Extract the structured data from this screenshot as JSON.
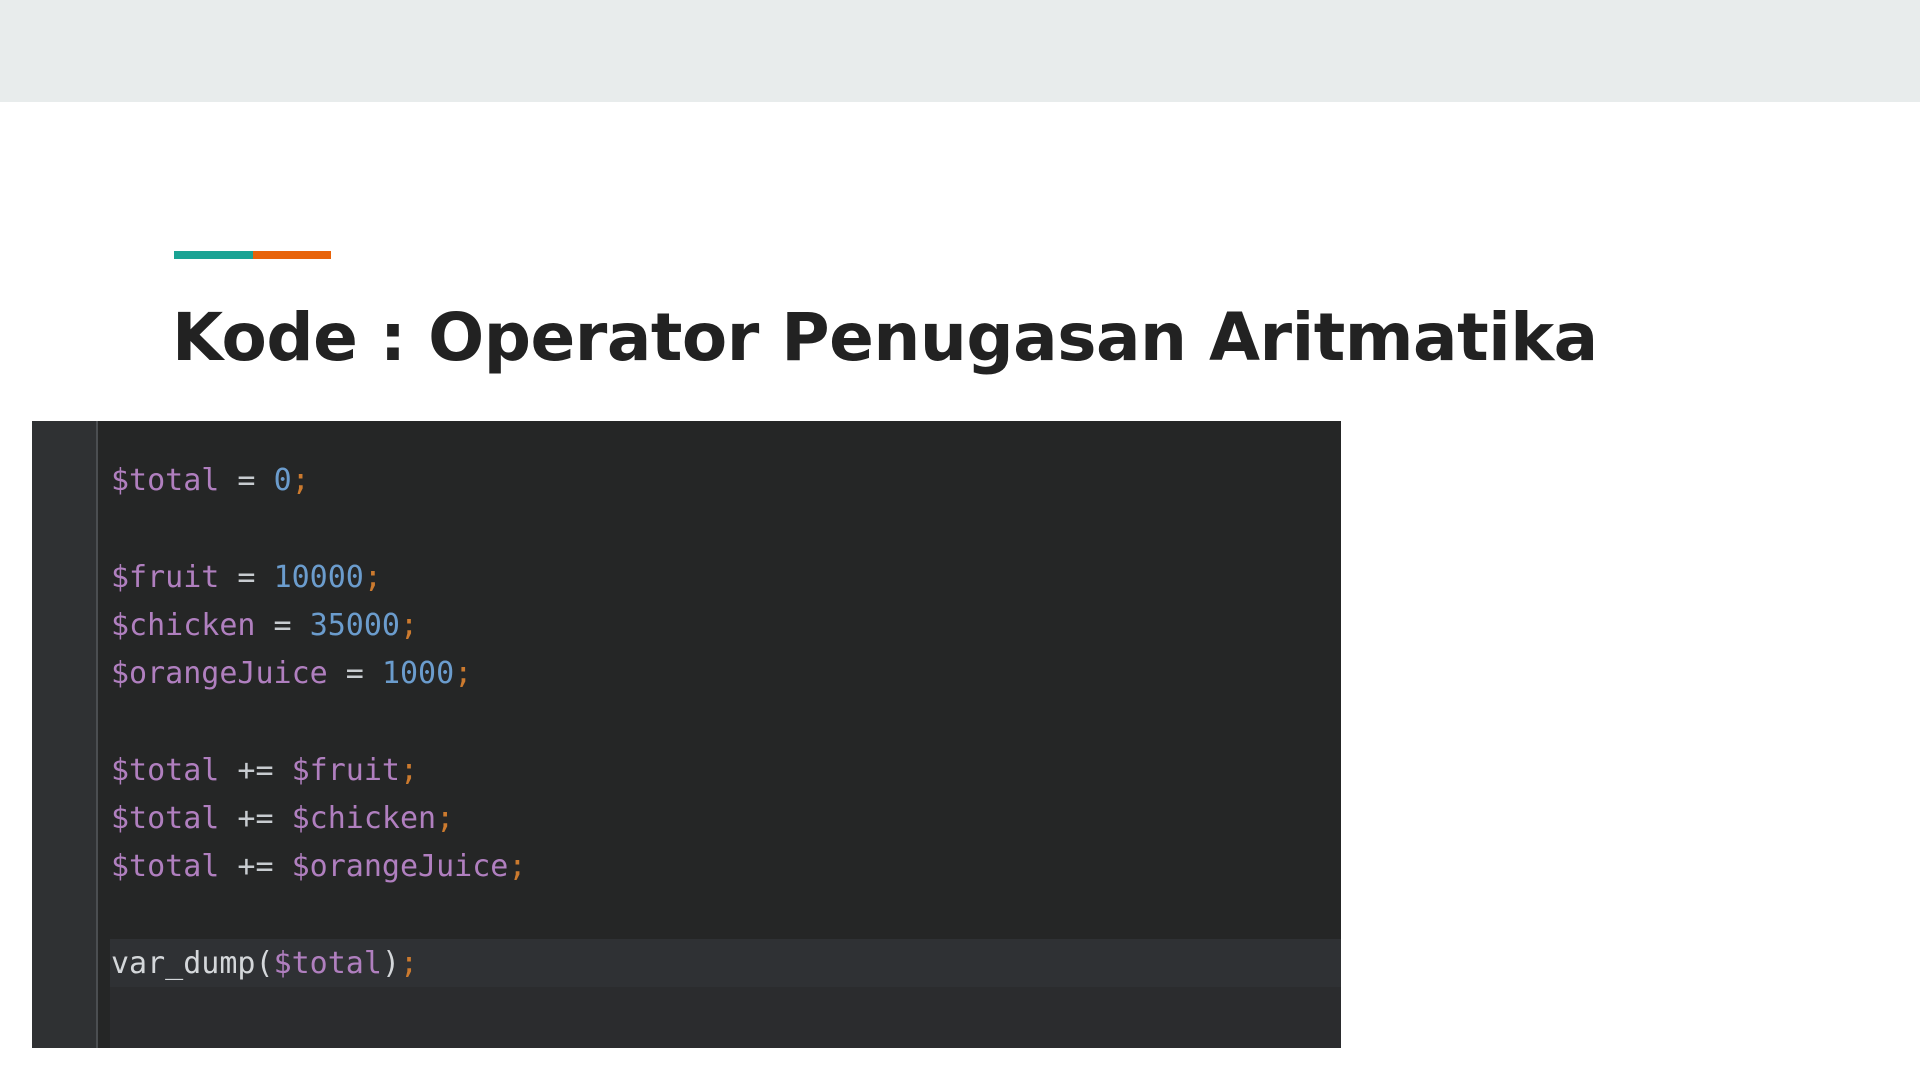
{
  "slide": {
    "title": "Kode : Operator Penugasan Aritmatika",
    "accent_colors": {
      "teal": "#1aa394",
      "orange": "#e8630a"
    }
  },
  "code": {
    "lines": [
      {
        "tokens": [
          {
            "t": "$total",
            "k": "var"
          },
          {
            "t": " = ",
            "k": "op"
          },
          {
            "t": "0",
            "k": "num"
          },
          {
            "t": ";",
            "k": "punc"
          }
        ]
      },
      {
        "tokens": []
      },
      {
        "tokens": [
          {
            "t": "$fruit",
            "k": "var"
          },
          {
            "t": " = ",
            "k": "op"
          },
          {
            "t": "10000",
            "k": "num"
          },
          {
            "t": ";",
            "k": "punc"
          }
        ]
      },
      {
        "tokens": [
          {
            "t": "$chicken",
            "k": "var"
          },
          {
            "t": " = ",
            "k": "op"
          },
          {
            "t": "35000",
            "k": "num"
          },
          {
            "t": ";",
            "k": "punc"
          }
        ]
      },
      {
        "tokens": [
          {
            "t": "$orangeJuice",
            "k": "var"
          },
          {
            "t": " = ",
            "k": "op"
          },
          {
            "t": "1000",
            "k": "num"
          },
          {
            "t": ";",
            "k": "punc"
          }
        ]
      },
      {
        "tokens": []
      },
      {
        "tokens": [
          {
            "t": "$total",
            "k": "var"
          },
          {
            "t": " += ",
            "k": "op"
          },
          {
            "t": "$fruit",
            "k": "var"
          },
          {
            "t": ";",
            "k": "punc"
          }
        ]
      },
      {
        "tokens": [
          {
            "t": "$total",
            "k": "var"
          },
          {
            "t": " += ",
            "k": "op"
          },
          {
            "t": "$chicken",
            "k": "var"
          },
          {
            "t": ";",
            "k": "punc"
          }
        ]
      },
      {
        "tokens": [
          {
            "t": "$total",
            "k": "var"
          },
          {
            "t": " += ",
            "k": "op"
          },
          {
            "t": "$orangeJuice",
            "k": "var"
          },
          {
            "t": ";",
            "k": "punc"
          }
        ]
      },
      {
        "tokens": []
      },
      {
        "tokens": [
          {
            "t": "var_dump(",
            "k": "fn"
          },
          {
            "t": "$total",
            "k": "var"
          },
          {
            "t": ")",
            "k": "fn"
          },
          {
            "t": ";",
            "k": "punc"
          }
        ]
      }
    ]
  }
}
